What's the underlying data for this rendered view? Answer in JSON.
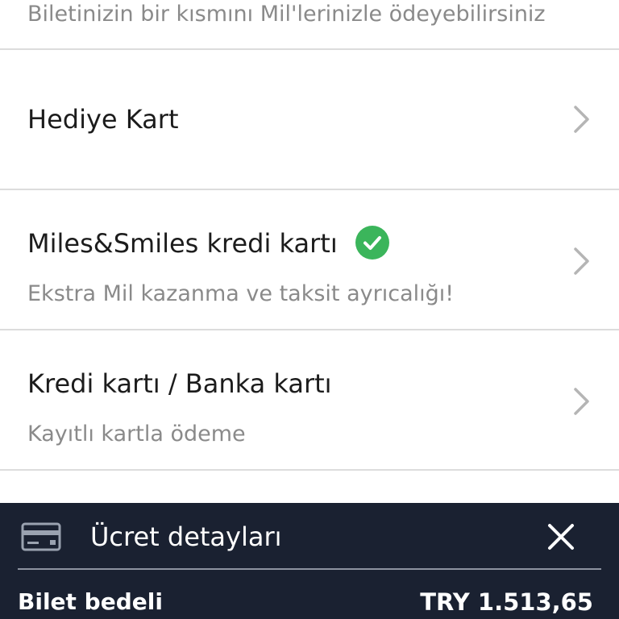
{
  "miles_option": {
    "subtitle": "Biletinizin bir kısmını Mil'lerinizle ödeyebilirsiniz"
  },
  "gift_card": {
    "title": "Hediye Kart"
  },
  "miles_smiles_card": {
    "title": "Miles&Smiles kredi kartı",
    "subtitle": "Ekstra Mil kazanma ve taksit ayrıcalığı!",
    "verified": true
  },
  "credit_card": {
    "title": "Kredi kartı / Banka kartı",
    "subtitle": "Kayıtlı kartla ödeme"
  },
  "fare_details": {
    "title": "Ücret detayları",
    "ticket_label": "Bilet bedeli",
    "ticket_amount": "TRY 1.513,65"
  },
  "colors": {
    "footer_bg": "#1a2131",
    "check_green": "#3bb55b",
    "chevron_gray": "#b5b5b5"
  },
  "icons": {
    "chevron": "chevron-right-icon",
    "check": "check-circle-icon",
    "card": "credit-card-icon",
    "close": "close-icon"
  }
}
